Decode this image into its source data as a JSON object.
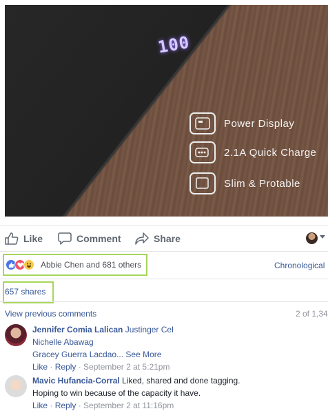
{
  "hero": {
    "display_text": "100",
    "features": [
      {
        "label": "Power Display",
        "icon": "power-display-icon"
      },
      {
        "label": "2.1A Quick Charge",
        "icon": "battery-charge-icon"
      },
      {
        "label": "Slim & Protable",
        "icon": "slim-device-icon"
      }
    ]
  },
  "actions": {
    "like_label": "Like",
    "comment_label": "Comment",
    "share_label": "Share"
  },
  "reactions": {
    "summary": "Abbie Chen and 681 others",
    "sort_label": "Chronological",
    "types": [
      "like-reaction-icon",
      "love-reaction-icon",
      "haha-reaction-icon"
    ]
  },
  "shares": {
    "label": "657 shares"
  },
  "comments": {
    "view_previous": "View previous comments",
    "count": "2 of 1,34",
    "items": [
      {
        "author": "Jennifer Comia Lalican",
        "tags": [
          "Justinger Cel",
          "Nichelle Abawag",
          "Gracey Guerra Lacdao..."
        ],
        "see_more": "See More",
        "like": "Like",
        "reply": "Reply",
        "time": "September 2 at 5:21pm"
      },
      {
        "author": "Mavic Hufancia-Corral",
        "text_line1": "Liked, shared and done tagging.",
        "text_line2": "Hoping to win because of the capacity it have.",
        "like": "Like",
        "reply": "Reply",
        "time": "September 2 at 11:16pm"
      }
    ]
  },
  "colors": {
    "link_blue": "#385898",
    "highlight_green": "#a8d65c",
    "like_blue": "#4a76e8",
    "love_red": "#f25268",
    "haha_yellow": "#f7c94b"
  }
}
